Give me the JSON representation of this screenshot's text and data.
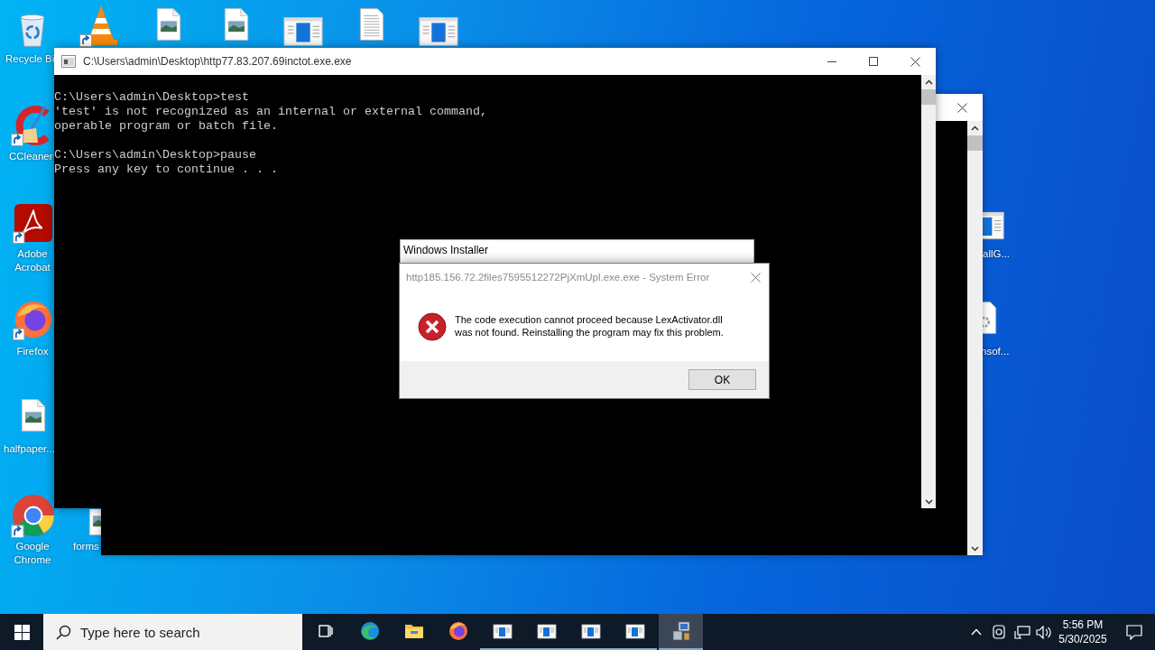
{
  "desktop": {
    "icons": [
      {
        "kind": "recycle-bin",
        "label": "Recycle Bi",
        "shortcut": false
      },
      {
        "kind": "ccleaner",
        "label": "CCleaner",
        "shortcut": true
      },
      {
        "kind": "pdf",
        "label": "Adobe Acrobat",
        "shortcut": true
      },
      {
        "kind": "firefox",
        "label": "Firefox",
        "shortcut": true
      },
      {
        "kind": "image-file",
        "label": "halfpaper...",
        "shortcut": false
      },
      {
        "kind": "chrome",
        "label": "Google Chrome",
        "shortcut": true
      },
      {
        "kind": "image-file",
        "label": "forms",
        "shortcut": false
      },
      {
        "kind": "cone",
        "shortcut": true
      },
      {
        "kind": "image-file",
        "shortcut": false
      },
      {
        "kind": "image-file",
        "shortcut": false
      },
      {
        "kind": "doc-window",
        "shortcut": false
      },
      {
        "kind": "text-file",
        "shortcut": false
      },
      {
        "kind": "doc-window",
        "shortcut": false
      },
      {
        "kind": "doc-window",
        "label": "allG..."
      },
      {
        "kind": "settings-file",
        "label": "nsof..."
      }
    ]
  },
  "console": {
    "title": "C:\\Users\\admin\\Desktop\\http77.83.207.69inctot.exe.exe",
    "blocks": [
      [
        "C:\\Users\\admin\\Desktop>test",
        "'test' is not recognized as an internal or external command,",
        "operable program or batch file."
      ],
      [
        "C:\\Users\\admin\\Desktop>pause",
        "Press any key to continue . . ."
      ]
    ]
  },
  "installer_window": {
    "title": "Windows Installer"
  },
  "error_dialog": {
    "title": "http185.156.72.2files7595512272PjXmUpl.exe.exe - System Error",
    "message": "The code execution cannot proceed because LexActivator.dll\nwas not found. Reinstalling the program may fix this problem.",
    "buttons": [
      "OK"
    ]
  },
  "taskbar": {
    "search_placeholder": "Type here to search",
    "apps": [
      {
        "kind": "task-view",
        "running": false,
        "selected": false
      },
      {
        "kind": "edge",
        "running": false,
        "selected": false
      },
      {
        "kind": "explorer",
        "running": false,
        "selected": false
      },
      {
        "kind": "firefox",
        "running": false,
        "selected": false
      },
      {
        "kind": "doc-window",
        "running": true,
        "selected": false
      },
      {
        "kind": "doc-window",
        "running": true,
        "selected": false
      },
      {
        "kind": "doc-window",
        "running": true,
        "selected": false
      },
      {
        "kind": "doc-window",
        "running": true,
        "selected": false
      },
      {
        "kind": "installer",
        "running": true,
        "selected": true
      }
    ],
    "time": "5:56 PM",
    "date": "5/30/2025"
  }
}
